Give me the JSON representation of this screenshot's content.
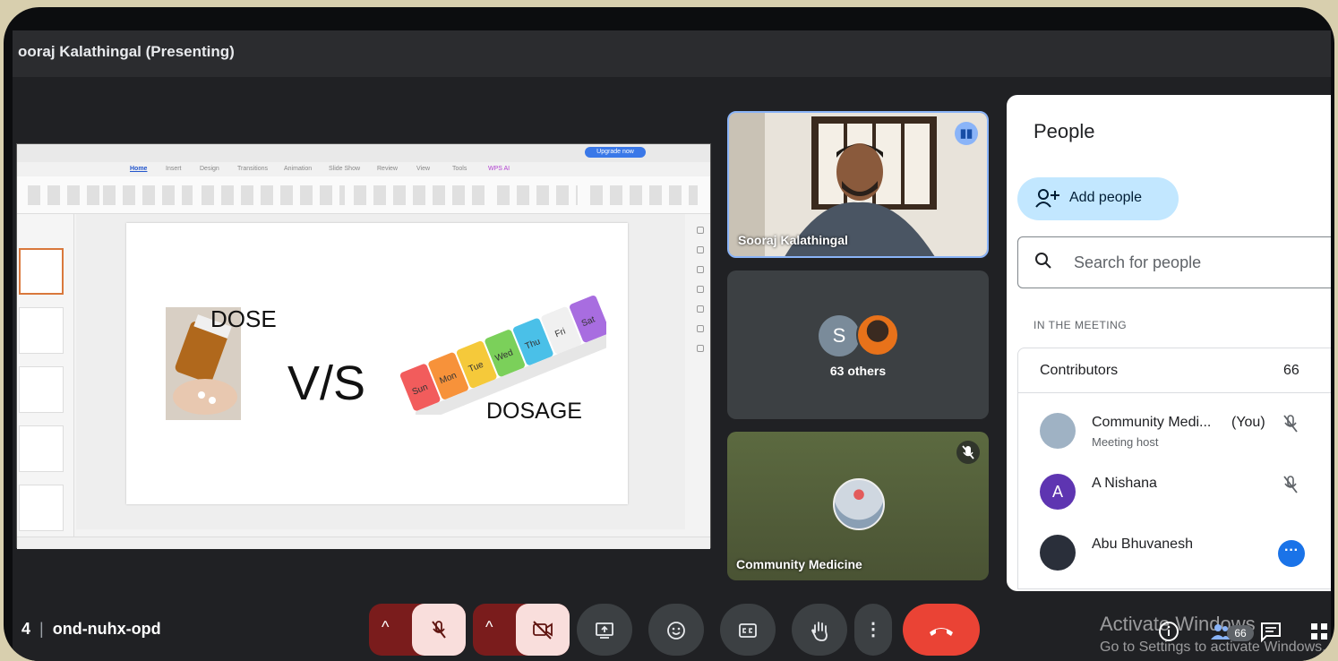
{
  "header": {
    "presenter_title": "ooraj Kalathingal (Presenting)"
  },
  "slide": {
    "left_label": "DOSE",
    "middle_label": "V/S",
    "right_label": "DOSAGE",
    "pill_days": [
      "Sun",
      "Mon",
      "Tue",
      "Wed",
      "Thu",
      "Fri",
      "Sat"
    ]
  },
  "ppt": {
    "menu": [
      "Home",
      "Insert",
      "Design",
      "Transitions",
      "Animation",
      "Slide Show",
      "Review",
      "View",
      "Tools",
      "WPS AI"
    ],
    "upgrade_label": "Upgrade now"
  },
  "tiles": {
    "speaker_name": "Sooraj Kalathingal",
    "others_initial": "S",
    "others_label": "63 others",
    "community_name": "Community Medicine"
  },
  "people": {
    "title": "People",
    "add_people_label": "Add people",
    "search_placeholder": "Search for people",
    "section_label": "IN THE MEETING",
    "contributors_label": "Contributors",
    "contributors_count": "66",
    "list": [
      {
        "name": "Community Medi...",
        "subtitle": "Meeting host",
        "you_tag": "(You)",
        "initial": "",
        "color": "#9fb2c4"
      },
      {
        "name": "A Nishana",
        "subtitle": "",
        "you_tag": "",
        "initial": "A",
        "color": "#5e35b1"
      },
      {
        "name": "Abu Bhuvanesh",
        "subtitle": "",
        "you_tag": "",
        "initial": "",
        "color": "#2a2f3a"
      }
    ]
  },
  "bottom": {
    "meeting_code": "ond-nuhx-opd",
    "separator": "|",
    "clock_fragment": "4",
    "participants_badge": "66",
    "watermark_line1": "Activate Windows",
    "watermark_line2": "Go to Settings to activate Windows."
  }
}
